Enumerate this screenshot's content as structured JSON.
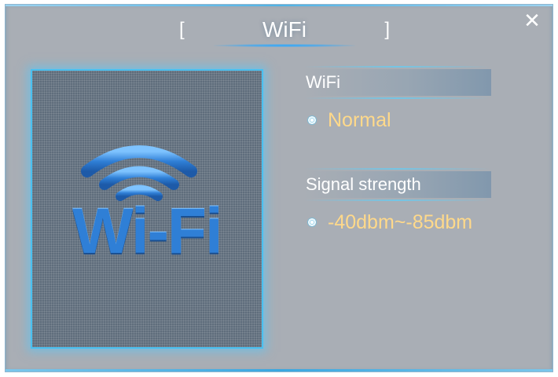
{
  "window": {
    "title": "WiFi",
    "bracket_left": "[",
    "bracket_right": "]",
    "close_symbol": "✕"
  },
  "image": {
    "logo_text": "Wi-Fi",
    "icon": "wifi-logo-icon"
  },
  "sections": [
    {
      "label": "WiFi",
      "value": "Normal",
      "icon": "bullet-icon"
    },
    {
      "label": "Signal strength",
      "value": "-40dbm~-85dbm",
      "icon": "bullet-icon"
    }
  ],
  "colors": {
    "background": "#a9aeb5",
    "value_text": "#ffd98a",
    "accent_glow": "#49c0f0",
    "logo_blue": "#2f7fd6"
  }
}
